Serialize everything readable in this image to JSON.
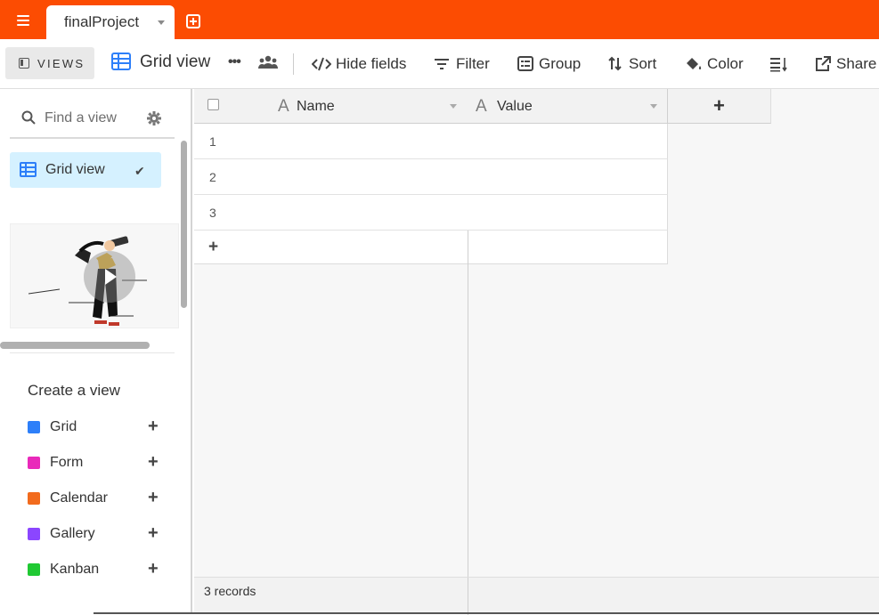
{
  "app": {
    "tab_title": "finalProject",
    "accent_color": "#fc4c02"
  },
  "toolbar": {
    "views_label": "VIEWS",
    "view_name": "Grid view",
    "buttons": [
      {
        "label": "Hide fields",
        "icon": "hide-fields-icon"
      },
      {
        "label": "Filter",
        "icon": "filter-icon"
      },
      {
        "label": "Group",
        "icon": "group-icon"
      },
      {
        "label": "Sort",
        "icon": "sort-icon"
      },
      {
        "label": "Color",
        "icon": "color-bucket-icon"
      },
      {
        "label": "",
        "icon": "row-height-icon"
      },
      {
        "label": "Share",
        "icon": "share-icon"
      }
    ]
  },
  "sidebar": {
    "search_placeholder": "Find a view",
    "views": [
      {
        "label": "Grid view",
        "selected": true
      }
    ],
    "create_title": "Create a view",
    "create_items": [
      {
        "label": "Grid",
        "color": "#2d7ff9",
        "plus": "+"
      },
      {
        "label": "Form",
        "color": "#e929ba",
        "plus": "+"
      },
      {
        "label": "Calendar",
        "color": "#f26b1d",
        "plus": "+"
      },
      {
        "label": "Gallery",
        "color": "#8b46ff",
        "plus": "+"
      },
      {
        "label": "Kanban",
        "color": "#20c933",
        "plus": "+"
      }
    ]
  },
  "grid": {
    "fields": [
      {
        "label": "Name",
        "type_icon": "A"
      },
      {
        "label": "Value",
        "type_icon": "A"
      }
    ],
    "add_field_label": "+",
    "rows": [
      {
        "num": "1",
        "name": "",
        "value": ""
      },
      {
        "num": "2",
        "name": "",
        "value": ""
      },
      {
        "num": "3",
        "name": "",
        "value": ""
      }
    ],
    "add_row_label": "+",
    "record_count": "3 records"
  }
}
